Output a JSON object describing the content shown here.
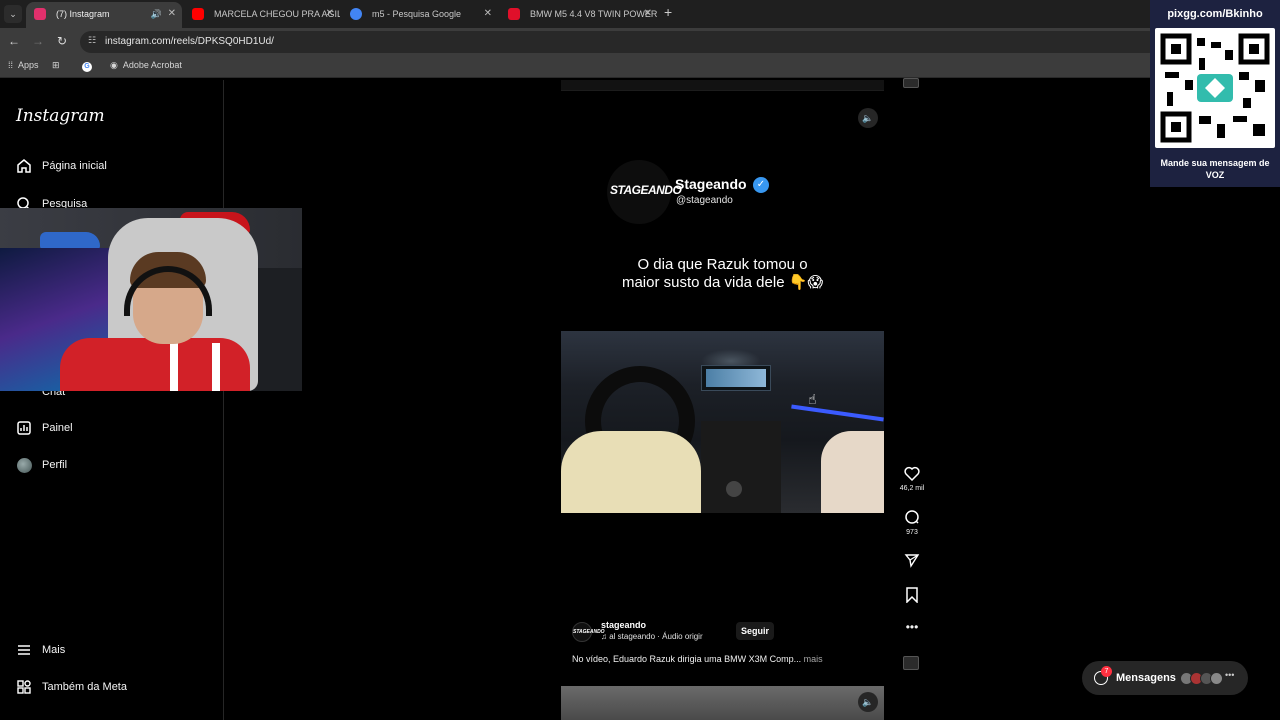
{
  "browser": {
    "tabs": [
      {
        "label": "(7) Instagram",
        "active": true,
        "favicon_color": "#e1306c",
        "audio": true
      },
      {
        "label": "MARCELA CHEGOU PRA AGILIZ",
        "active": false,
        "favicon_color": "#ff0000"
      },
      {
        "label": "m5 - Pesquisa Google",
        "active": false,
        "favicon_color": "#4285f4"
      },
      {
        "label": "BMW M5 4.4 V8 TWIN POWER",
        "active": false,
        "favicon_color": "#e0102a"
      }
    ],
    "url": "instagram.com/reels/DPKSQ0HD1Ud/",
    "bookmarks": [
      {
        "label": "Apps",
        "icon": "grid-icon"
      },
      {
        "label": "",
        "icon": "apps-grid-icon"
      },
      {
        "label": "",
        "icon": "google-icon"
      },
      {
        "label": "Adobe Acrobat",
        "icon": "acrobat-icon"
      }
    ]
  },
  "sidebar": {
    "logo": "Instagram",
    "items": [
      {
        "label": "Página inicial",
        "icon": "home-icon"
      },
      {
        "label": "Pesquisa",
        "icon": "search-icon"
      },
      {
        "label": "Chat",
        "icon": "chat-icon"
      },
      {
        "label": "Painel",
        "icon": "dashboard-icon"
      },
      {
        "label": "Perfil",
        "icon": "avatar-icon"
      }
    ],
    "bottom_items": [
      {
        "label": "Mais",
        "icon": "menu-icon"
      },
      {
        "label": "Também da Meta",
        "icon": "meta-icon"
      }
    ]
  },
  "reel": {
    "account_logo": "STAGEANDO",
    "account_name": "Stageando",
    "account_handle": "@stageando",
    "caption_line1": "O dia que Razuk tomou o",
    "caption_line2": "maior susto da vida dele 👇😱",
    "actions": {
      "likes": "46,2 mil",
      "comments": "973"
    },
    "post": {
      "author": "stageando",
      "avatar_text": "STAGEANDO",
      "audio": "al      stageando · Áudio origir",
      "follow_label": "Seguir",
      "description": "No vídeo, Eduardo Razuk dirigia uma BMW X3M Comp...",
      "more_label": "mais"
    }
  },
  "messages": {
    "label": "Mensagens",
    "badge": "7"
  },
  "donation_overlay": {
    "url": "pixgg.com/Bkinho",
    "message": "Mande sua mensagem de VOZ"
  },
  "colors": {
    "accent_blue": "#3897f0",
    "notification_red": "#ff3040",
    "background": "#000000"
  }
}
